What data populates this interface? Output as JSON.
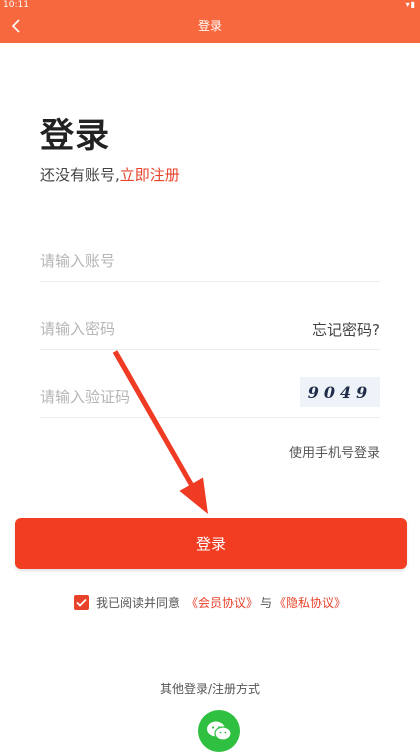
{
  "status_bar": {
    "time": "10:11"
  },
  "header": {
    "title": "登录"
  },
  "main": {
    "heading": "登录",
    "no_account_text": "还没有账号,",
    "register_link": "立即注册",
    "account_placeholder": "请输入账号",
    "password_placeholder": "请输入密码",
    "forgot_password": "忘记密码?",
    "captcha_placeholder": "请输入验证码",
    "captcha_code": "9049",
    "phone_login": "使用手机号登录",
    "login_button": "登录"
  },
  "agreement": {
    "checked": true,
    "prefix": "我已阅读并同意",
    "member_agreement": "《会员协议》",
    "conjunction": "与",
    "privacy_agreement": "《隐私协议》"
  },
  "other_login": {
    "label": "其他登录/注册方式",
    "icon": "wechat-icon"
  },
  "colors": {
    "brand": "#f7683e",
    "button": "#f23d22",
    "accent": "#e8432a",
    "wechat": "#2fbf41"
  }
}
